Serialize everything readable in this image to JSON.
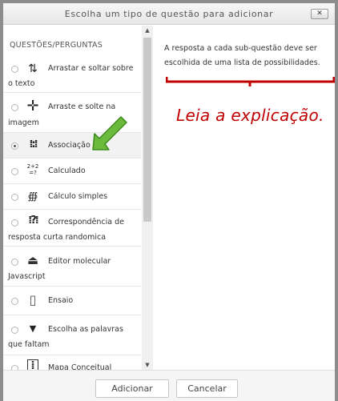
{
  "dialog": {
    "title": "Escolha um tipo de questão para adicionar",
    "close_icon": "close-icon"
  },
  "list": {
    "header": "QUESTÕES/PERGUNTAS",
    "items": [
      {
        "line1": "Arrastar e soltar sobre",
        "line2": "o texto",
        "icon": "drag-drop-text-icon",
        "selected": false
      },
      {
        "line1": "Arraste e solte na",
        "line2": "imagem",
        "icon": "drag-drop-image-icon",
        "selected": false
      },
      {
        "line1": "Associação",
        "line2": "",
        "icon": "matching-icon",
        "selected": true
      },
      {
        "line1": "Calculado",
        "line2": "",
        "icon": "calculated-icon",
        "selected": false
      },
      {
        "line1": "Cálculo simples",
        "line2": "",
        "icon": "calculated-simple-icon",
        "selected": false
      },
      {
        "line1": "Correspondência de",
        "line2": "resposta curta randomica",
        "icon": "random-short-answer-icon",
        "selected": false
      },
      {
        "line1": "Editor molecular",
        "line2": "Javascript",
        "icon": "molecule-editor-icon",
        "selected": false
      },
      {
        "line1": "Ensaio",
        "line2": "",
        "icon": "essay-icon",
        "selected": false
      },
      {
        "line1": "Escolha as palavras",
        "line2": "que faltam",
        "icon": "select-missing-words-icon",
        "selected": false
      },
      {
        "line1": "Mapa Conceitual",
        "line2": "",
        "icon": "concept-map-icon",
        "selected": false
      }
    ]
  },
  "description": {
    "text": "A resposta a cada sub-questão deve ser escolhida de uma lista de possibilidades."
  },
  "annotation": {
    "hint": "Leia a explicação.",
    "arrow_color": "#5aa832",
    "bracket_color": "#c00000"
  },
  "footer": {
    "add_label": "Adicionar",
    "cancel_label": "Cancelar"
  }
}
